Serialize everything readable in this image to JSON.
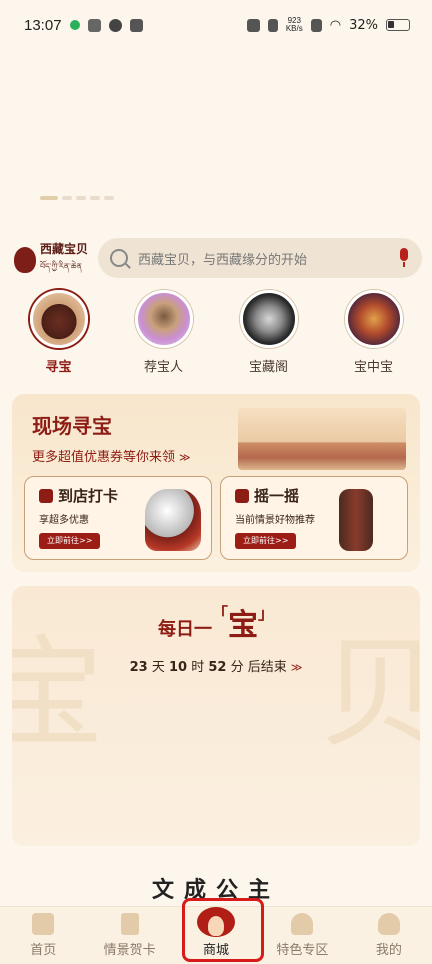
{
  "status_bar": {
    "time": "13:07",
    "speed_value": "923",
    "speed_unit": "KB/s",
    "battery": "32%"
  },
  "banner": {
    "indicator_count": 5,
    "active_index": 0
  },
  "brand": {
    "name": "西藏宝贝",
    "tibetan": "བོད་ཀྱི་རིན་ཆེན"
  },
  "search": {
    "placeholder": "西藏宝贝，与西藏缘分的开始"
  },
  "categories": [
    {
      "label": "寻宝",
      "active": true,
      "color": "#6b2e22"
    },
    {
      "label": "荐宝人",
      "active": false,
      "color": "#c98fd1"
    },
    {
      "label": "宝藏阁",
      "active": false,
      "color": "#2a2a2a"
    },
    {
      "label": "宝中宝",
      "active": false,
      "color": "#8a3b2c"
    }
  ],
  "live_card": {
    "title": "现场寻宝",
    "subtitle": "更多超值优惠券等你来领",
    "checkin": {
      "title": "到店打卡",
      "desc": "享超多优惠",
      "button": "立即前往>>"
    },
    "shake": {
      "title": "摇一摇",
      "desc": "当前情景好物推荐",
      "button": "立即前往>>"
    }
  },
  "daily_card": {
    "title_prefix": "每日一",
    "title_main": "宝",
    "bg_left": "宝",
    "bg_right": "贝",
    "countdown": {
      "days": "23",
      "days_unit": "天",
      "hours": "10",
      "hours_unit": "时",
      "minutes": "52",
      "minutes_unit": "分",
      "suffix": "后结束"
    }
  },
  "section_title": "文成公主",
  "nav": [
    {
      "label": "首页",
      "icon": "home-icon"
    },
    {
      "label": "情景贺卡",
      "icon": "card-icon"
    },
    {
      "label": "商城",
      "icon": "mall-icon",
      "active": true
    },
    {
      "label": "特色专区",
      "icon": "feature-icon"
    },
    {
      "label": "我的",
      "icon": "profile-icon"
    }
  ],
  "colors": {
    "brand": "#8d1c14",
    "accent_red": "#b01e15",
    "background": "#fdf6ec"
  }
}
